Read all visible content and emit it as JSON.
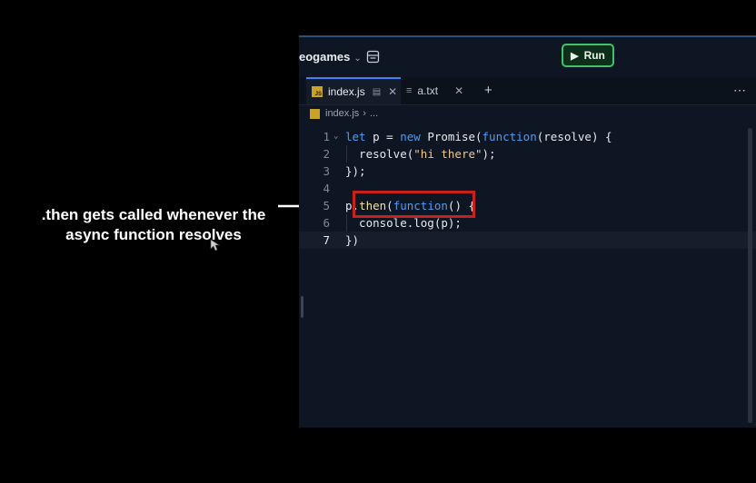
{
  "annotation": {
    "text": ".then gets called whenever the async function resolves"
  },
  "ide": {
    "repo_name": "eogames",
    "run_button": "Run",
    "tabs": [
      {
        "label": "index.js",
        "active": true
      },
      {
        "label": "a.txt",
        "active": false
      }
    ],
    "breadcrumb": {
      "file": "index.js",
      "ellipsis": "..."
    },
    "code_lines": [
      {
        "num": "1",
        "tokens": [
          [
            "kw",
            "let"
          ],
          [
            "plain",
            " p = "
          ],
          [
            "kw",
            "new"
          ],
          [
            "plain",
            " Promise("
          ],
          [
            "kw",
            "function"
          ],
          [
            "plain",
            "(resolve) {"
          ]
        ]
      },
      {
        "num": "2",
        "tokens": [
          [
            "plain",
            "  resolve("
          ],
          [
            "str",
            "\"hi there\""
          ],
          [
            "plain",
            ");"
          ]
        ]
      },
      {
        "num": "3",
        "tokens": [
          [
            "plain",
            "});"
          ]
        ]
      },
      {
        "num": "4",
        "tokens": []
      },
      {
        "num": "5",
        "tokens": [
          [
            "plain",
            "p."
          ],
          [
            "fn",
            "then"
          ],
          [
            "plain",
            "("
          ],
          [
            "kw",
            "function"
          ],
          [
            "plain",
            "() {"
          ]
        ]
      },
      {
        "num": "6",
        "tokens": [
          [
            "plain",
            "  console.log(p);"
          ]
        ]
      },
      {
        "num": "7",
        "tokens": [
          [
            "plain",
            "})"
          ]
        ]
      }
    ]
  },
  "colors": {
    "keyword": "#4f9cf0",
    "string": "#f0c98c",
    "run_border": "#3fc36a",
    "highlight_box": "#c8201c"
  }
}
